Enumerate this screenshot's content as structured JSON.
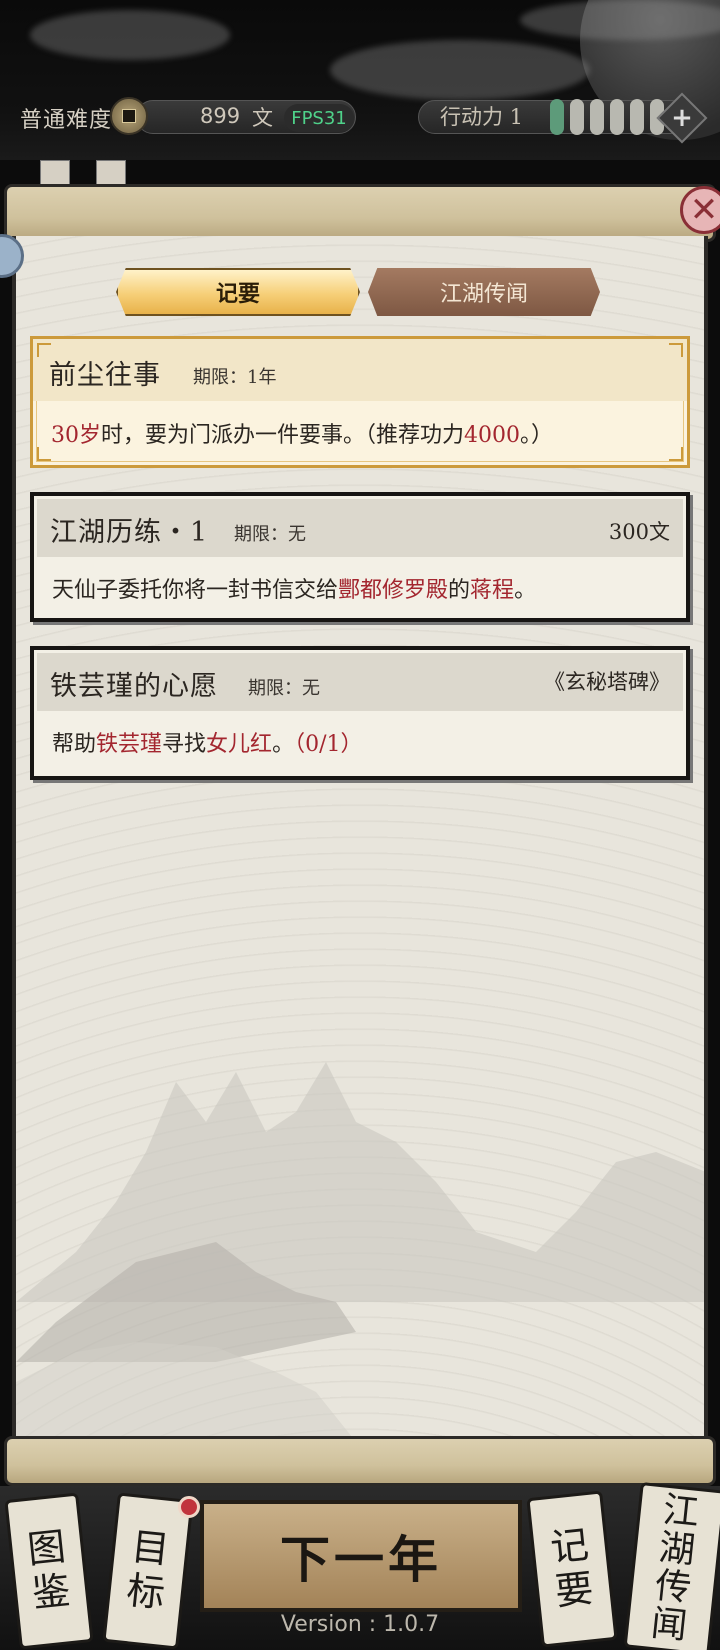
{
  "header": {
    "difficulty": "普通难度",
    "money": "899",
    "money_unit": "文",
    "fps": "FPS31",
    "action_label": "行动力 1",
    "action_bars": 6,
    "action_filled": 1,
    "plus_icon": "plus-icon",
    "coin_icon": "coin-icon"
  },
  "tabs": [
    {
      "label": "记要",
      "active": true
    },
    {
      "label": "江湖传闻",
      "active": false
    }
  ],
  "quests": [
    {
      "title": "前尘往事",
      "limit_label": "期限：",
      "limit_value": "1年",
      "desc_parts": [
        {
          "text": "30岁",
          "highlight": true
        },
        {
          "text": "时，要为门派办一件要事。（推荐功力",
          "highlight": false
        },
        {
          "text": "4000",
          "highlight": true
        },
        {
          "text": "。）",
          "highlight": false
        }
      ]
    },
    {
      "title": "江湖历练・1",
      "limit_label": "期限：",
      "limit_value": "无",
      "reward": "300文",
      "desc_parts": [
        {
          "text": "天仙子委托你将一封书信交给",
          "highlight": false
        },
        {
          "text": "酆都修罗殿",
          "highlight": true
        },
        {
          "text": "的",
          "highlight": false
        },
        {
          "text": "蒋程",
          "highlight": true
        },
        {
          "text": "。",
          "highlight": false
        }
      ]
    },
    {
      "title": "铁芸瑾的心愿",
      "limit_label": "期限：",
      "limit_value": "无",
      "source": "《玄秘塔碑》",
      "desc_parts": [
        {
          "text": "帮助",
          "highlight": false
        },
        {
          "text": "铁芸瑾",
          "highlight": true
        },
        {
          "text": "寻找",
          "highlight": false
        },
        {
          "text": "女儿红",
          "highlight": true
        },
        {
          "text": "。",
          "highlight": false
        },
        {
          "text": "（0/1）",
          "highlight": true
        }
      ]
    }
  ],
  "bottom_nav": {
    "tujian": [
      "图",
      "鉴"
    ],
    "mubiao": [
      "目",
      "标"
    ],
    "next_year": "下一年",
    "jiyao": [
      "记",
      "要"
    ],
    "jianghu": [
      "江",
      "湖",
      "传",
      "闻"
    ],
    "version": "Version : 1.0.7"
  },
  "colors": {
    "highlight": "#a3262f",
    "gold_border": "#cc9a3b",
    "fps_green": "#4fd28a"
  },
  "close_icon": "close-icon"
}
